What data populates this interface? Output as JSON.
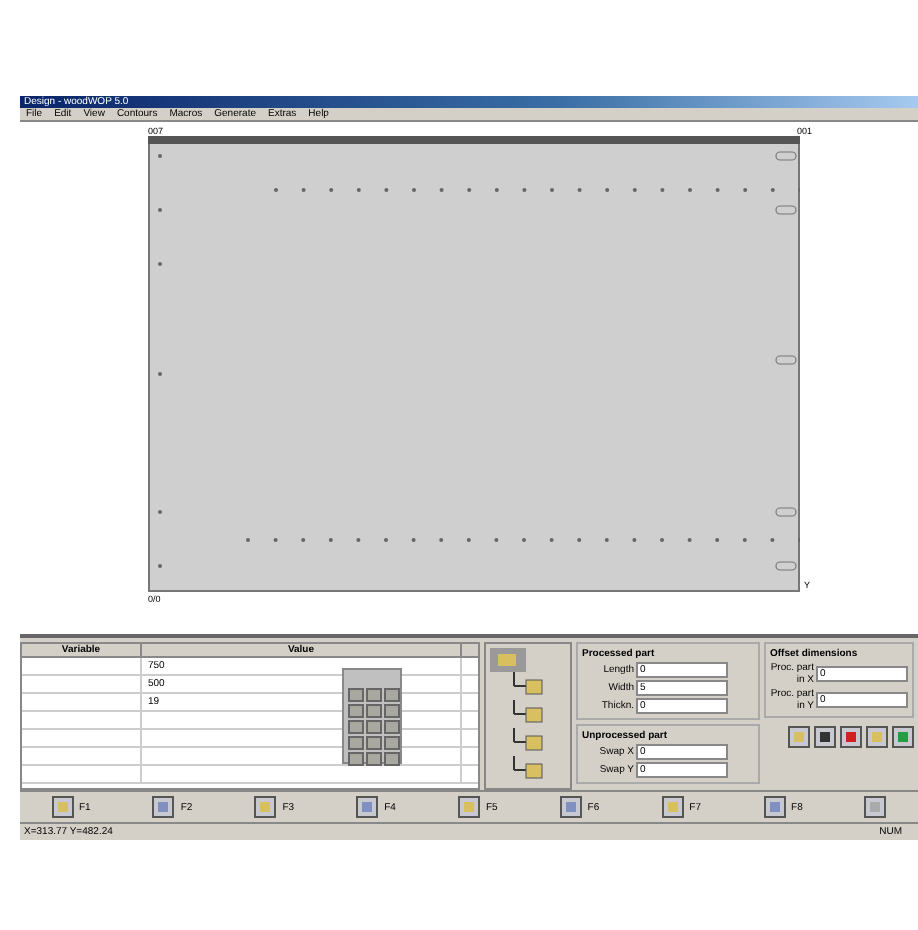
{
  "window": {
    "title": "Design - woodWOP 5.0"
  },
  "menu": [
    "File",
    "Edit",
    "View",
    "Contours",
    "Macros",
    "Generate",
    "Extras",
    "Help"
  ],
  "ruler": {
    "left_label": "007",
    "right_label": "001"
  },
  "canvas": {
    "origin_label": "0/0",
    "axis_label": "Y"
  },
  "variables": {
    "columns": [
      "Variable",
      "Value"
    ],
    "values": [
      "750",
      "500",
      "19"
    ]
  },
  "processed_part": {
    "title": "Processed part",
    "fields": [
      {
        "label": "Length",
        "value": "0"
      },
      {
        "label": "Width",
        "value": "5"
      },
      {
        "label": "Thickn.",
        "value": "0"
      }
    ]
  },
  "unprocessed_part": {
    "title": "Unprocessed part",
    "fields": [
      {
        "label": "Swap X",
        "value": "0"
      },
      {
        "label": "Swap Y",
        "value": "0"
      }
    ]
  },
  "offset": {
    "title": "Offset dimensions",
    "fields": [
      {
        "label": "Proc. part in X",
        "value": "0"
      },
      {
        "label": "Proc. part in Y",
        "value": "0"
      }
    ]
  },
  "function_keys": [
    "F1",
    "F2",
    "F3",
    "F4",
    "F5",
    "F6",
    "F7",
    "F8"
  ],
  "status_bar": {
    "coordinates": "X=313.77   Y=482.24",
    "mode": "NUM"
  }
}
